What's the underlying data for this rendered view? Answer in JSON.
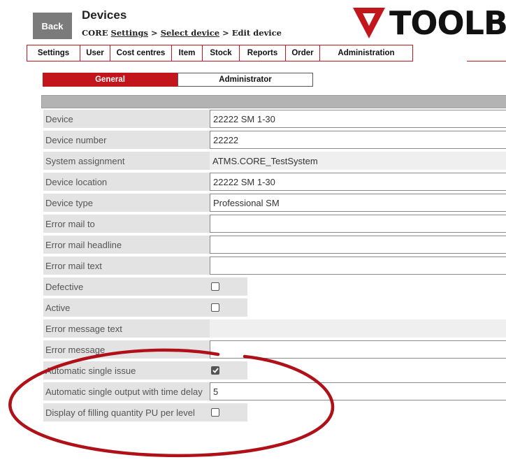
{
  "header": {
    "back_label": "Back",
    "title": "Devices",
    "breadcrumb": {
      "prefix": "CORE",
      "settings": "Settings",
      "sep1": ">",
      "select": "Select device",
      "sep2": ">",
      "current": "Edit device"
    },
    "logo_text": "TOOLB",
    "logo_color": "#c3161c"
  },
  "nav": {
    "tabs": [
      "Settings",
      "User",
      "Cost centres",
      "Item",
      "Stock",
      "Reports",
      "Order",
      "Administration"
    ],
    "accent": "#c3161c"
  },
  "subtabs": {
    "general": "General",
    "administrator": "Administrator",
    "active": "General"
  },
  "form": {
    "rows": [
      {
        "label": "Device",
        "type": "text",
        "value": "22222 SM 1-30"
      },
      {
        "label": "Device number",
        "type": "text",
        "value": "22222"
      },
      {
        "label": "System assignment",
        "type": "readonly",
        "value": "ATMS.CORE_TestSystem"
      },
      {
        "label": "Device location",
        "type": "text",
        "value": "22222 SM 1-30"
      },
      {
        "label": "Device type",
        "type": "text",
        "value": "Professional SM"
      },
      {
        "label": "Error mail to",
        "type": "text",
        "value": ""
      },
      {
        "label": "Error mail headline",
        "type": "text",
        "value": ""
      },
      {
        "label": "Error mail text",
        "type": "text",
        "value": ""
      },
      {
        "label": "Defective",
        "type": "checkbox",
        "checked": false
      },
      {
        "label": "Active",
        "type": "checkbox",
        "checked": false
      },
      {
        "label": "Error message text",
        "type": "readonly",
        "value": ""
      },
      {
        "label": "Error message",
        "type": "text",
        "value": ""
      },
      {
        "label": "Automatic single issue",
        "type": "checkbox",
        "checked": true
      },
      {
        "label": "Automatic single output with time delay",
        "type": "text",
        "value": "5"
      },
      {
        "label": "Display of filling quantity PU per level",
        "type": "checkbox",
        "checked": false
      }
    ]
  },
  "annotation": {
    "shape": "ellipse",
    "color": "#b01018"
  }
}
